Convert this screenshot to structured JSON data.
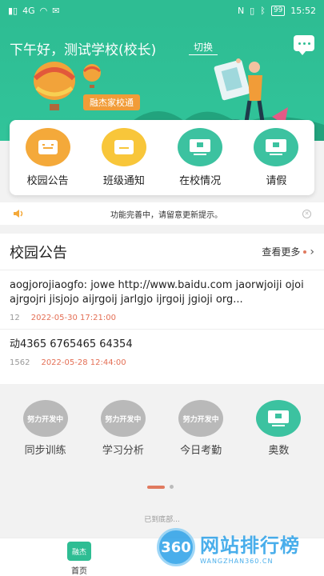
{
  "status_bar": {
    "time": "15:52",
    "battery": "99",
    "net": "4G"
  },
  "header": {
    "greeting": "下午好，测试学校(校长)",
    "switch_label": "切换",
    "banner_tag": "融杰家校通"
  },
  "menu": [
    {
      "label": "校园公告",
      "color": "#f4a93a"
    },
    {
      "label": "班级通知",
      "color": "#f8c63a"
    },
    {
      "label": "在校情况",
      "color": "#3cc2a0"
    },
    {
      "label": "请假",
      "color": "#3cc2a0"
    }
  ],
  "notice": {
    "text": "功能完善中，请留意更新提示。"
  },
  "announcements": {
    "title": "校园公告",
    "more_label": "查看更多",
    "items": [
      {
        "text": "aogjorojiaogfo: jowe http://www.baidu.com jaorwjoiji ojoi ajrgojri jisjojo aijrgoij jarlgjo ijrgoij jgioji org...",
        "views": "12",
        "time": "2022-05-30 17:21:00"
      },
      {
        "text": "动4365 6765465 64354",
        "views": "1562",
        "time": "2022-05-28 12:44:00"
      }
    ]
  },
  "features": [
    {
      "label": "同步训练",
      "badge": "努力开发中",
      "active": false
    },
    {
      "label": "学习分析",
      "badge": "努力开发中",
      "active": false
    },
    {
      "label": "今日考勤",
      "badge": "努力开发中",
      "active": false
    },
    {
      "label": "奥数",
      "badge": "",
      "active": true
    }
  ],
  "footer": {
    "end_text": "已到底部..."
  },
  "tabbar": {
    "home_icon_text": "融杰",
    "home_label": "首页"
  },
  "watermark": {
    "logo": "360",
    "main": "网站排行榜",
    "sub": "WANGZHAN360.CN"
  },
  "colors": {
    "primary": "#2ebd93",
    "accent": "#e07a5f"
  }
}
